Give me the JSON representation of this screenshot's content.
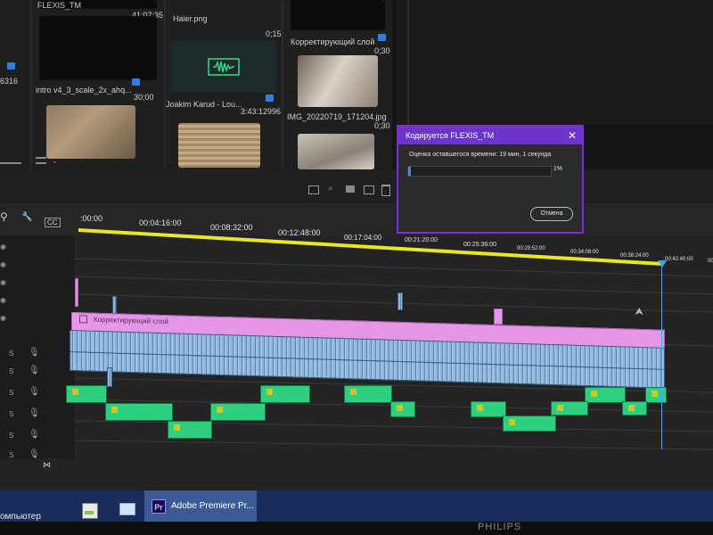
{
  "project_panel": {
    "items": [
      {
        "name": "FLEXIS_TM",
        "duration": "41:07:35"
      },
      {
        "name": "Haier.png",
        "duration": "0;15"
      },
      {
        "name": "Корректирующий слой",
        "duration": "0;30"
      },
      {
        "name": "intro v4_3_scale_2x_ahq...",
        "duration": "30;00"
      },
      {
        "name": "Joakim Karud - Lou...",
        "duration": "3:43:12996"
      },
      {
        "name": "IMG_20220719_171204.jpg",
        "duration": "0;30"
      }
    ],
    "partial_value": "6316"
  },
  "export_dialog": {
    "title": "Кодируется FLEXIS_TM",
    "close": "✕",
    "message": "Оценка оставшегося времени: 19 мин, 1 секунда",
    "progress_percent": 1,
    "progress_label": "1%",
    "cancel_label": "Отмена"
  },
  "timeline": {
    "ruler": [
      ":00:00",
      "00:04:16:00",
      "00:08:32:00",
      "00:12:48:00",
      "00:17:04:00",
      "00:21:20:00",
      "00:25:36:00",
      "00:29:52:00",
      "00:34:08:00",
      "00:38:24:00",
      "00:42:40:00",
      "00"
    ],
    "adjustment_clip_label": "Корректирующий слой",
    "cc_label": "CC"
  },
  "taskbar": {
    "computer_label": "омпьютер",
    "premiere_label": "Adobe Premiere Pr...",
    "premiere_icon": "Pr"
  },
  "monitor_brand": "PHILIPS",
  "colors": {
    "dialog_title": "#6a35c8",
    "audio_clip": "#2ecf7f",
    "video_clip": "#8fb6d9",
    "adjustment_clip": "#e596e6",
    "playhead": "#4aa3ff",
    "work_area": "#e8e820"
  }
}
